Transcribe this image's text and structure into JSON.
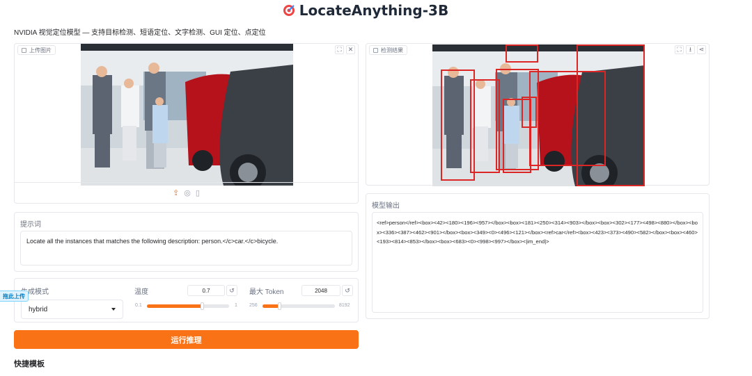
{
  "app": {
    "title": "LocateAnything-3B",
    "subtitle": "NVIDIA 视觉定位模型 — 支持目标检测、短语定位、文字检测、GUI 定位、点定位"
  },
  "upload_panel": {
    "label": "上传图片",
    "fullscreen_icon": "⛶",
    "close_icon": "✕",
    "tools": [
      "upload-icon",
      "webcam-icon",
      "clipboard-icon"
    ]
  },
  "result_panel": {
    "label": "检测结果",
    "fullscreen_icon": "⛶",
    "download_icon": "⭳",
    "share_icon": "⋖"
  },
  "prompt": {
    "label": "提示词",
    "value": "Locate all the instances that matches the following description: person.</c>car.</c>bicycle."
  },
  "output": {
    "label": "模型输出",
    "value": "<ref>person</ref><box><42><180><196><957></box><box><181><250><314><903></box><box><302><177><498><880></box><box><336><387><462><901></box><box><349><0><496><121></box><ref>car</ref><box><423><373><490><582></box><box><460><193><814><853></box><box><683><0><998><997></box><|im_end|>"
  },
  "controls": {
    "mode_label": "生成模式",
    "mode_value": "hybrid",
    "temperature_label": "温度",
    "temperature_value": "0.7",
    "temperature_min": "0.1",
    "temperature_max": "1",
    "temperature_level": 0.67,
    "max_token_label": "最大 Token",
    "max_token_value": "2048",
    "max_token_min": "256",
    "max_token_max": "8192",
    "max_token_level": 0.23,
    "reset_icon": "↺"
  },
  "run_button": "运行推理",
  "quick_templates": "快捷模板",
  "float_tag": "拖此上传",
  "colors": {
    "accent": "#f97316",
    "box": "#dc2626"
  }
}
